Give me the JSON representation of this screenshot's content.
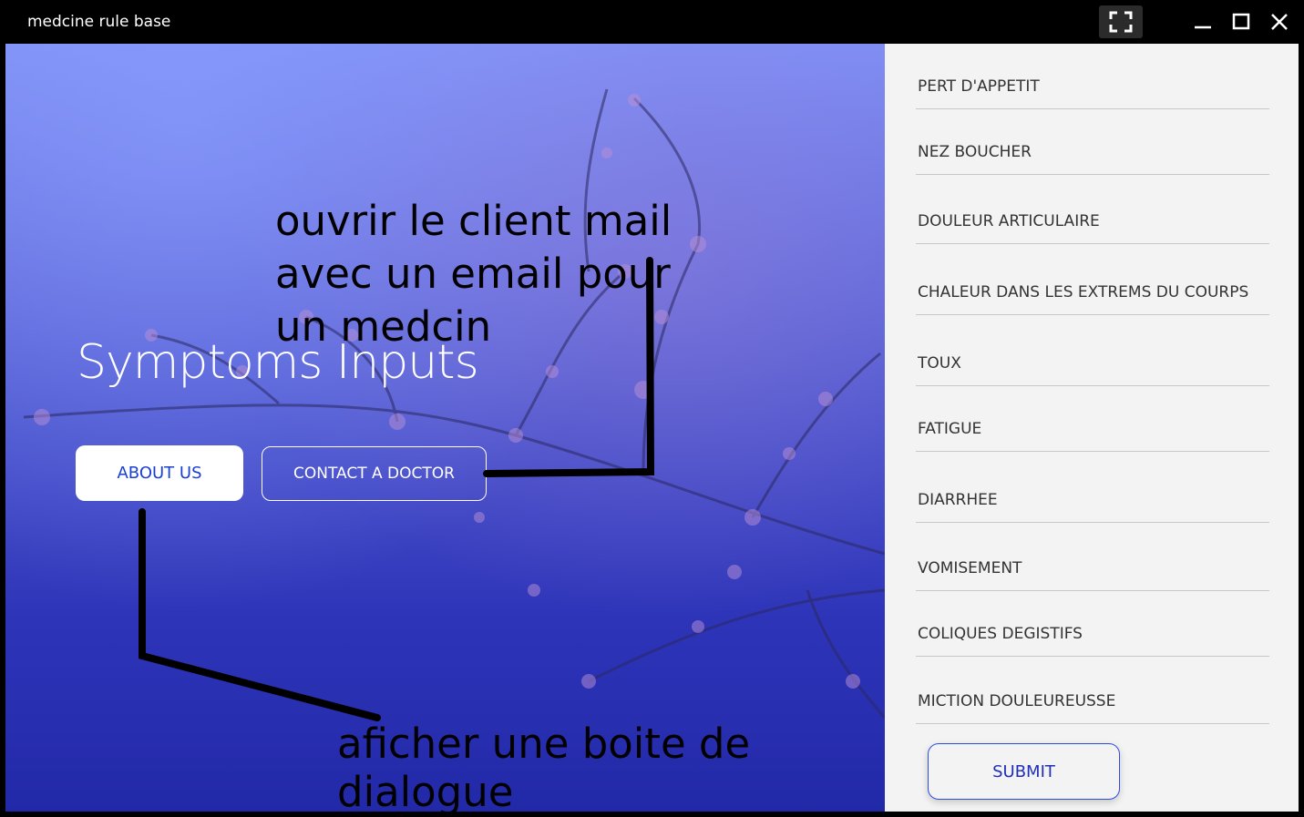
{
  "window": {
    "title": "medcine rule base"
  },
  "left_panel": {
    "heading": "Symptoms Inputs",
    "about_button": "ABOUT US",
    "contact_button": "CONTACT A DOCTOR",
    "annotation_contact": [
      "ouvrir le client mail",
      "avec un email pour",
      "un medcin"
    ],
    "annotation_about": "aficher une boite de dialogue"
  },
  "symptoms": [
    "PERT D'APPETIT",
    "NEZ BOUCHER",
    "DOULEUR ARTICULAIRE",
    "CHALEUR DANS LES EXTREMS DU COURPS",
    "TOUX",
    "FATIGUE",
    "DIARRHEE",
    "VOMISEMENT",
    "COLIQUES DEGISTIFS",
    "MICTION DOULEUREUSSE"
  ],
  "submit_button": "SUBMIT",
  "colors": {
    "accent": "#1a3fd6",
    "panel_bg": "#f3f3f3",
    "titlebar_bg": "#000000"
  },
  "icons": {
    "fullscreen": "fullscreen-icon",
    "minimize": "minimize-icon",
    "maximize": "maximize-icon",
    "close": "close-icon"
  }
}
